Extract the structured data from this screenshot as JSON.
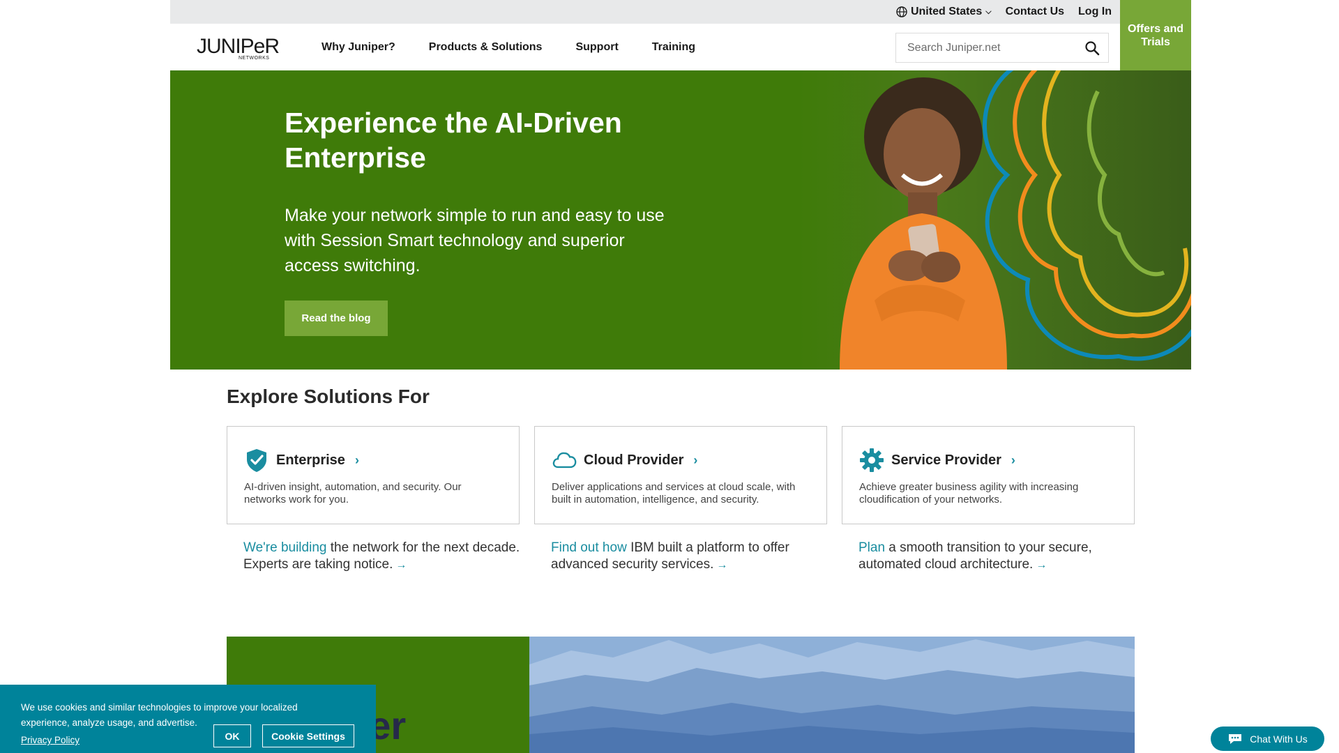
{
  "utility": {
    "region": "United States",
    "contact": "Contact Us",
    "login": "Log In",
    "offers": "Offers and Trials"
  },
  "nav": {
    "logo_alt": "Juniper Networks",
    "items": [
      "Why Juniper?",
      "Products & Solutions",
      "Support",
      "Training"
    ],
    "search_placeholder": "Search Juniper.net"
  },
  "hero": {
    "title": "Experience the AI-Driven Enterprise",
    "subtitle": "Make your network simple to run and easy to use with Session Smart technology and superior access switching.",
    "button": "Read the blog"
  },
  "explore": {
    "title": "Explore Solutions For",
    "cards": [
      {
        "icon": "shield-check-icon",
        "title": "Enterprise",
        "desc": "AI-driven insight, automation, and security. Our networks work for you."
      },
      {
        "icon": "cloud-icon",
        "title": "Cloud Provider",
        "desc": "Deliver applications and services at cloud scale, with built in automation, intelligence, and security."
      },
      {
        "icon": "gear-icon",
        "title": "Service Provider",
        "desc": "Achieve greater business agility with increasing cloudification of your networks."
      }
    ],
    "promos": [
      {
        "link": "We're building",
        "text": " the network for the next decade. Experts are taking notice."
      },
      {
        "link": "Find out how",
        "text": " IBM built a platform to offer advanced security services."
      },
      {
        "link": "Plan",
        "text": " a smooth transition to your secure, automated cloud architecture."
      }
    ]
  },
  "feature": {
    "big_word": "per"
  },
  "cookie": {
    "message": "We use cookies and similar technologies to improve your localized experience, analyze usage, and advertise.",
    "policy": "Privacy Policy",
    "ok": "OK",
    "settings": "Cookie Settings"
  },
  "chat": {
    "label": "Chat With Us"
  },
  "colors": {
    "brand_green": "#3f7b09",
    "accent_green": "#78a737",
    "teal": "#00839a",
    "link_teal": "#1a8da0"
  }
}
